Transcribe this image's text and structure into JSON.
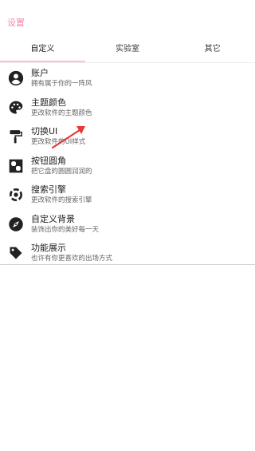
{
  "header": {
    "title": "设置"
  },
  "tabs": [
    {
      "label": "自定义",
      "active": true
    },
    {
      "label": "实验室",
      "active": false
    },
    {
      "label": "其它",
      "active": false
    }
  ],
  "colors": {
    "accent": "#f08aa6",
    "tab_indicator": "#f5c2cf",
    "icon": "#222222",
    "annotation_arrow": "#e53935"
  },
  "menu": {
    "items": [
      {
        "title": "账户",
        "subtitle": "拥有属于你的一阵风",
        "icon": "account-icon"
      },
      {
        "title": "主题颜色",
        "subtitle": "更改软件的主题颜色",
        "icon": "palette-icon"
      },
      {
        "title": "切换UI",
        "subtitle": "更改软件的UI样式",
        "icon": "paint-roller-icon"
      },
      {
        "title": "按钮圆角",
        "subtitle": "把它盘的圆圆润润的",
        "icon": "rounded-corner-icon"
      },
      {
        "title": "搜索引擎",
        "subtitle": "更改软件的搜索引擎",
        "icon": "search-engine-icon"
      },
      {
        "title": "自定义背景",
        "subtitle": "装饰出你的美好每一天",
        "icon": "compass-icon"
      },
      {
        "title": "功能展示",
        "subtitle": "也许有你更喜欢的出场方式",
        "icon": "tag-icon"
      }
    ]
  }
}
